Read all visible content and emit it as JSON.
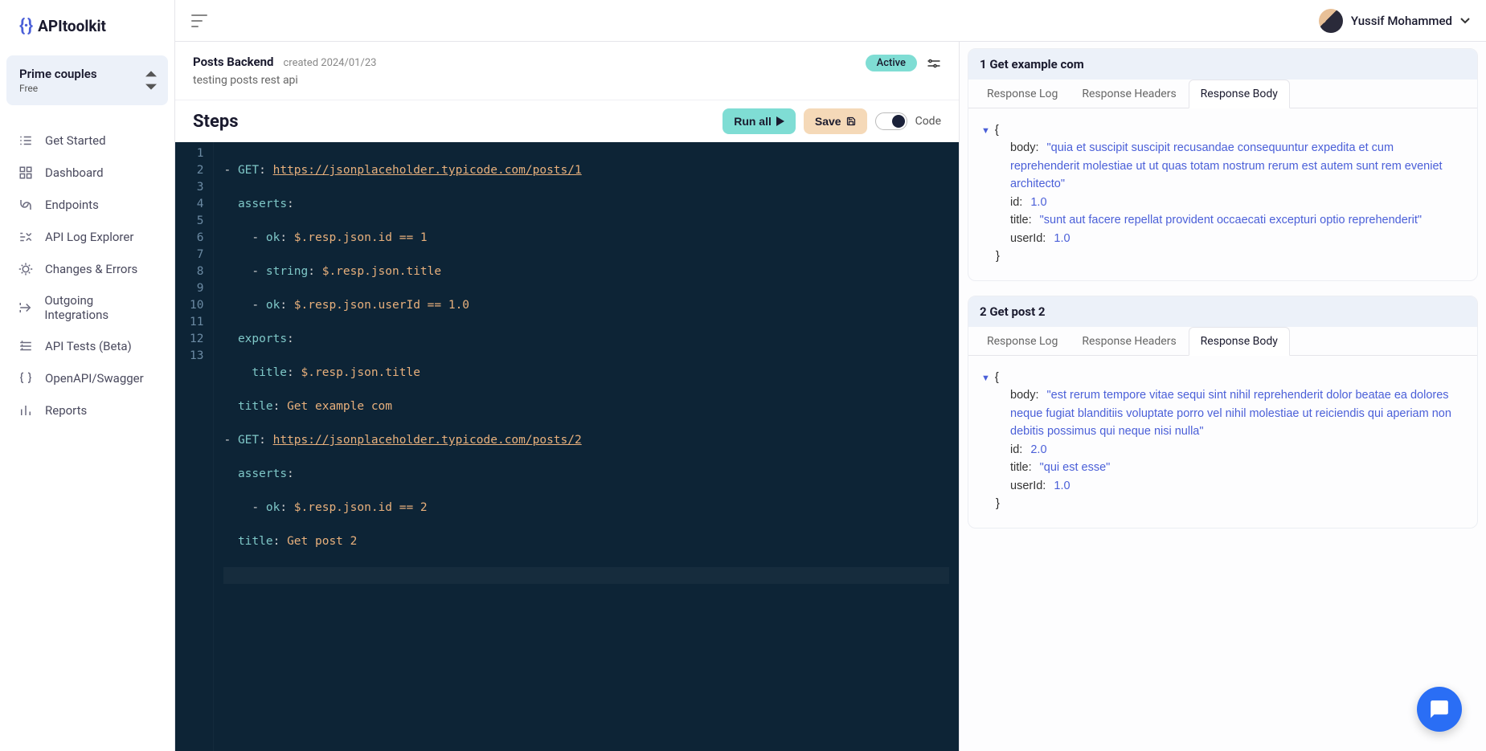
{
  "brand": {
    "icon": "{·}",
    "name": "APItoolkit"
  },
  "project": {
    "name": "Prime couples",
    "tier": "Free"
  },
  "nav": [
    {
      "label": "Get Started"
    },
    {
      "label": "Dashboard"
    },
    {
      "label": "Endpoints"
    },
    {
      "label": "API Log Explorer"
    },
    {
      "label": "Changes & Errors"
    },
    {
      "label": "Outgoing Integrations"
    },
    {
      "label": "API Tests (Beta)"
    },
    {
      "label": "OpenAPI/Swagger"
    },
    {
      "label": "Reports"
    }
  ],
  "user": {
    "name": "Yussif Mohammed"
  },
  "test": {
    "title": "Posts Backend",
    "created": "created 2024/01/23",
    "desc": "testing posts rest api",
    "status": "Active"
  },
  "steps": {
    "title": "Steps",
    "run_label": "Run all",
    "save_label": "Save",
    "toggle_label": "Code"
  },
  "editor_lines": [
    "1",
    "2",
    "3",
    "4",
    "5",
    "6",
    "7",
    "8",
    "9",
    "10",
    "11",
    "12",
    "13"
  ],
  "code": {
    "l1a": "- ",
    "l1b": "GET",
    "l1c": ": ",
    "l1d": "https://jsonplaceholder.typicode.com/posts/1",
    "l2a": "  ",
    "l2b": "asserts",
    "l2c": ":",
    "l3a": "    - ",
    "l3b": "ok",
    "l3c": ": ",
    "l3d": "$.resp.json.id == 1",
    "l4a": "    - ",
    "l4b": "string",
    "l4c": ": ",
    "l4d": "$.resp.json.title",
    "l5a": "    - ",
    "l5b": "ok",
    "l5c": ": ",
    "l5d": "$.resp.json.userId == 1.0",
    "l6a": "  ",
    "l6b": "exports",
    "l6c": ":",
    "l7a": "    ",
    "l7b": "title",
    "l7c": ": ",
    "l7d": "$.resp.json.title",
    "l8a": "  ",
    "l8b": "title",
    "l8c": ": ",
    "l8d": "Get example com",
    "l9a": "- ",
    "l9b": "GET",
    "l9c": ": ",
    "l9d": "https://jsonplaceholder.typicode.com/posts/2",
    "l10a": "  ",
    "l10b": "asserts",
    "l10c": ":",
    "l11a": "    - ",
    "l11b": "ok",
    "l11c": ": ",
    "l11d": "$.resp.json.id == 2",
    "l12a": "  ",
    "l12b": "title",
    "l12c": ": ",
    "l12d": "Get post 2"
  },
  "tabs": {
    "log": "Response Log",
    "headers": "Response Headers",
    "body": "Response Body"
  },
  "results": [
    {
      "title": "1 Get example com",
      "body": "\"quia et suscipit suscipit recusandae consequuntur expedita et cum reprehenderit molestiae ut ut quas totam nostrum rerum est autem sunt rem eveniet architecto\"",
      "id": "1.0",
      "titleVal": "\"sunt aut facere repellat provident occaecati excepturi optio reprehenderit\"",
      "userId": "1.0"
    },
    {
      "title": "2 Get post 2",
      "body": "\"est rerum tempore vitae sequi sint nihil reprehenderit dolor beatae ea dolores neque fugiat blanditiis voluptate porro vel nihil molestiae ut reiciendis qui aperiam non debitis possimus qui neque nisi nulla\"",
      "id": "2.0",
      "titleVal": "\"qui est esse\"",
      "userId": "1.0"
    }
  ],
  "json_keys": {
    "body": "body:",
    "id": "id:",
    "title": "title:",
    "userId": "userId:",
    "open": "{",
    "close": "}"
  }
}
